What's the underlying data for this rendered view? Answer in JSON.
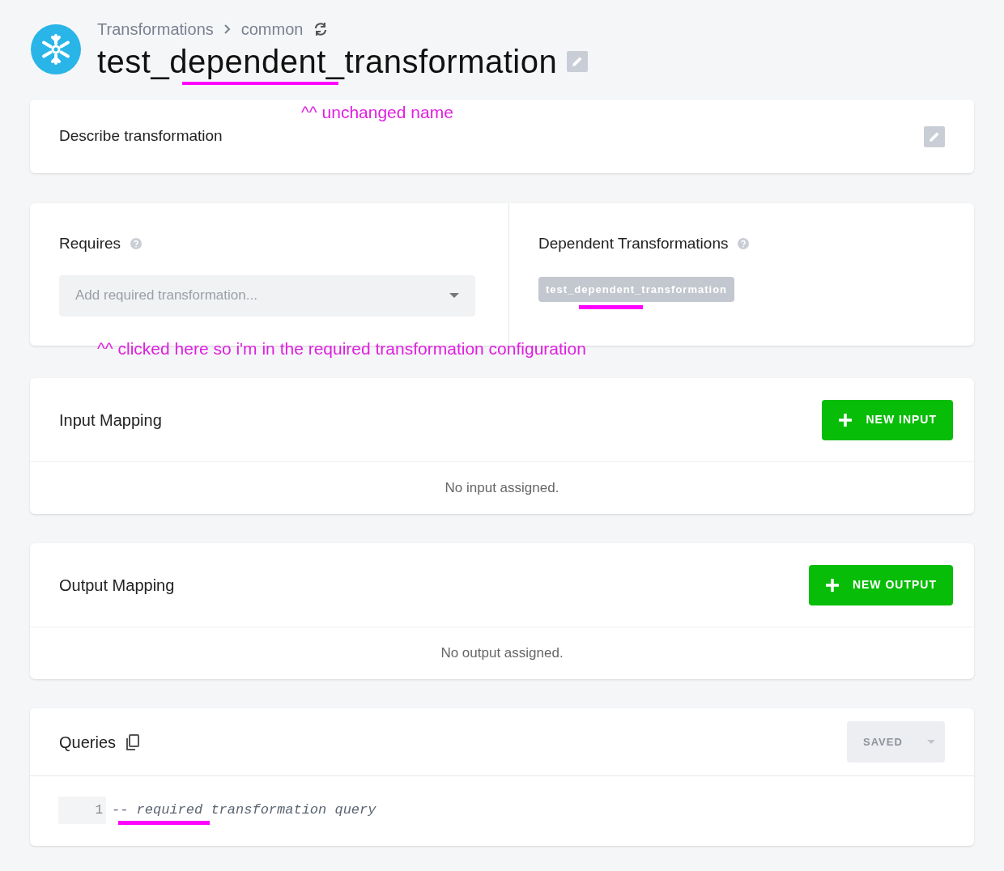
{
  "breadcrumb": [
    "Transformations",
    "common"
  ],
  "title": "test_dependent_transformation",
  "description": {
    "label": "Describe transformation"
  },
  "requires": {
    "label": "Requires",
    "placeholder": "Add required transformation..."
  },
  "dependent": {
    "label": "Dependent Transformations",
    "tags": [
      "test_dependent_transformation"
    ]
  },
  "input_mapping": {
    "title": "Input Mapping",
    "button": "NEW INPUT",
    "empty": "No input assigned."
  },
  "output_mapping": {
    "title": "Output Mapping",
    "button": "NEW OUTPUT",
    "empty": "No output assigned."
  },
  "queries": {
    "title": "Queries",
    "save_button": {
      "label": "SAVED",
      "disabled": true
    },
    "lines": [
      {
        "number": "1",
        "code": "-- required transformation query"
      }
    ]
  },
  "annotations": [
    "^^ unchanged name",
    "^^ clicked here so i'm in the required transformation configuration"
  ]
}
